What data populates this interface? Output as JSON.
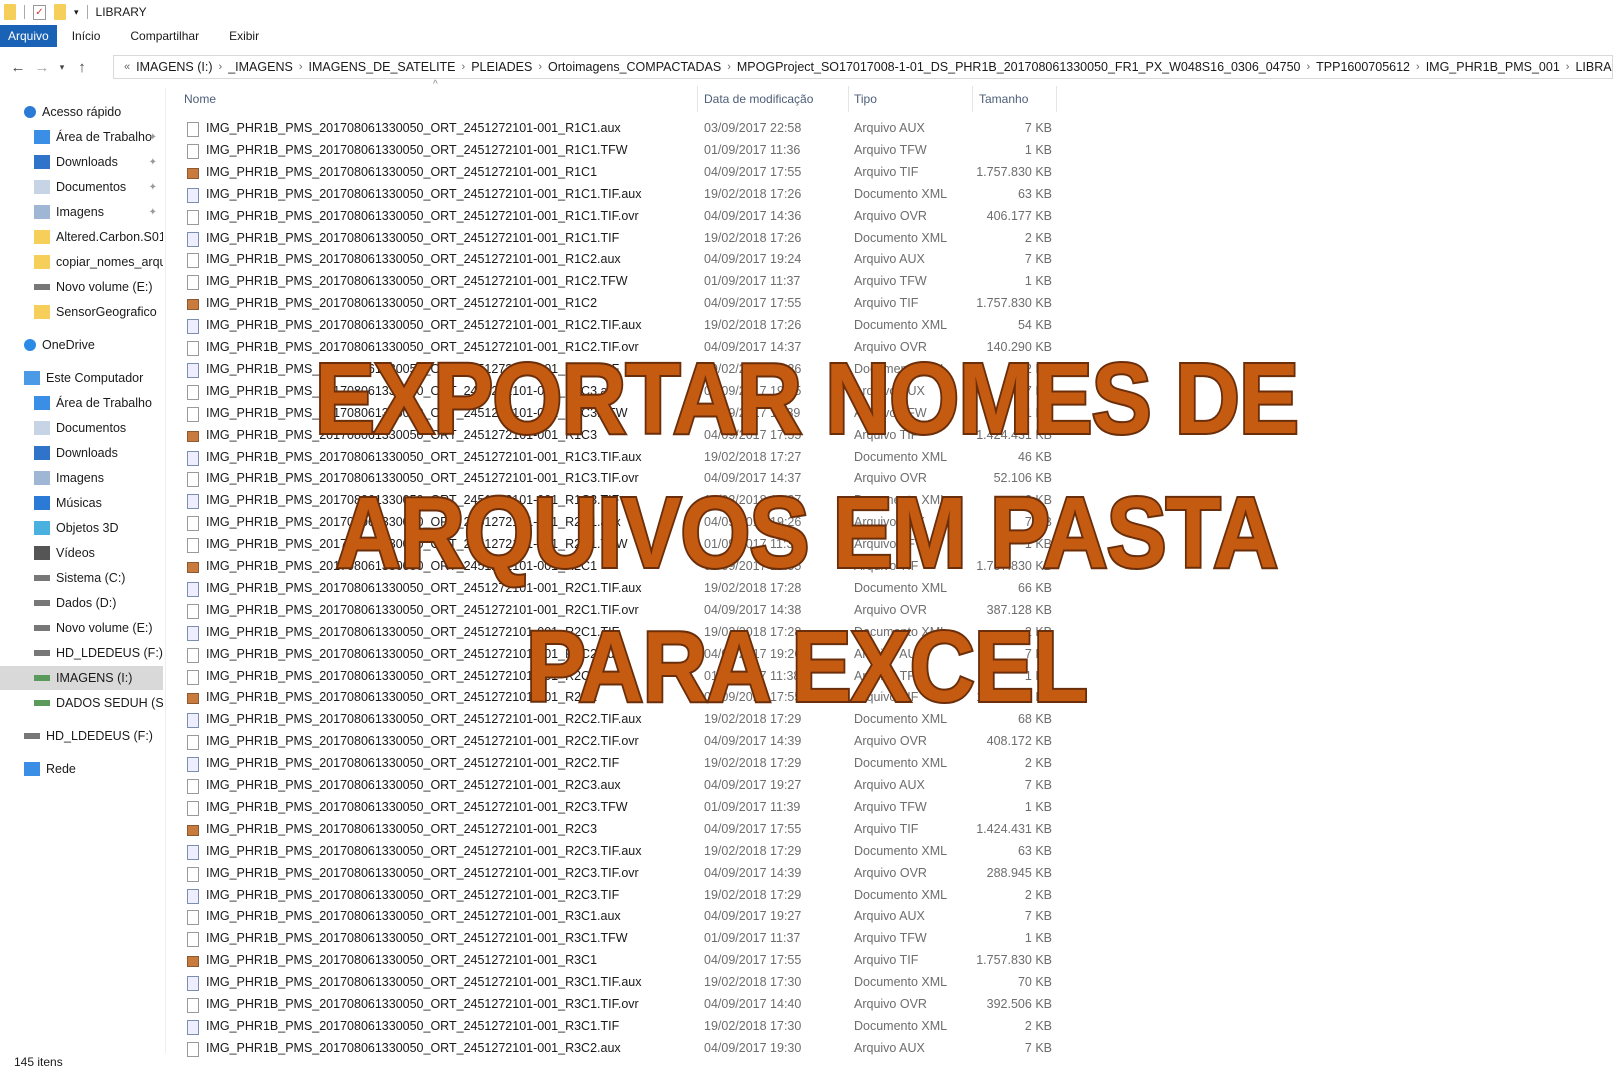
{
  "window": {
    "title": "LIBRARY"
  },
  "ribbon": {
    "tabs": [
      "Arquivo",
      "Início",
      "Compartilhar",
      "Exibir"
    ]
  },
  "address": {
    "prefix": "«",
    "crumbs": [
      "IMAGENS (I:)",
      "_IMAGENS",
      "IMAGENS_DE_SATELITE",
      "PLEIADES",
      "Ortoimagens_COMPACTADAS",
      "MPOGProject_SO17017008-1-01_DS_PHR1B_201708061330050_FR1_PX_W048S16_0306_04750",
      "TPP1600705612",
      "IMG_PHR1B_PMS_001",
      "LIBRARY"
    ]
  },
  "sidebar": {
    "items": [
      {
        "label": "Acesso rápido",
        "icon": "star-icon",
        "pinned": false,
        "level": 0
      },
      {
        "label": "Área de Trabalho",
        "icon": "desktop-icon",
        "pinned": true,
        "level": 1
      },
      {
        "label": "Downloads",
        "icon": "download-icon",
        "pinned": true,
        "level": 1
      },
      {
        "label": "Documentos",
        "icon": "document-icon",
        "pinned": true,
        "level": 1
      },
      {
        "label": "Imagens",
        "icon": "pictures-icon",
        "pinned": true,
        "level": 1
      },
      {
        "label": "Altered.Carbon.S01.",
        "icon": "folder-icon",
        "pinned": false,
        "level": 1
      },
      {
        "label": "copiar_nomes_arqu",
        "icon": "folder-icon",
        "pinned": false,
        "level": 1
      },
      {
        "label": "Novo volume (E:)",
        "icon": "drive-icon",
        "pinned": false,
        "level": 1
      },
      {
        "label": "SensorGeografico",
        "icon": "folder-icon",
        "pinned": false,
        "level": 1
      },
      {
        "label": "OneDrive",
        "icon": "cloud-icon",
        "pinned": false,
        "level": 0,
        "gap": true
      },
      {
        "label": "Este Computador",
        "icon": "computer-icon",
        "pinned": false,
        "level": 0,
        "gap": true
      },
      {
        "label": "Área de Trabalho",
        "icon": "desktop-icon",
        "pinned": false,
        "level": 1
      },
      {
        "label": "Documentos",
        "icon": "document-icon",
        "pinned": false,
        "level": 1
      },
      {
        "label": "Downloads",
        "icon": "download-icon",
        "pinned": false,
        "level": 1
      },
      {
        "label": "Imagens",
        "icon": "pictures-icon",
        "pinned": false,
        "level": 1
      },
      {
        "label": "Músicas",
        "icon": "music-icon",
        "pinned": false,
        "level": 1
      },
      {
        "label": "Objetos 3D",
        "icon": "cube-icon",
        "pinned": false,
        "level": 1
      },
      {
        "label": "Vídeos",
        "icon": "video-icon",
        "pinned": false,
        "level": 1
      },
      {
        "label": "Sistema (C:)",
        "icon": "drive-icon",
        "pinned": false,
        "level": 1
      },
      {
        "label": "Dados (D:)",
        "icon": "drive-icon",
        "pinned": false,
        "level": 1
      },
      {
        "label": "Novo volume (E:)",
        "icon": "drive-icon",
        "pinned": false,
        "level": 1
      },
      {
        "label": "HD_LDEDEUS (F:)",
        "icon": "drive-icon",
        "pinned": false,
        "level": 1
      },
      {
        "label": "IMAGENS (I:)",
        "icon": "network-drive-icon",
        "pinned": false,
        "level": 1,
        "selected": true
      },
      {
        "label": "DADOS SEDUH (S:)",
        "icon": "network-drive-icon",
        "pinned": false,
        "level": 1
      },
      {
        "label": "HD_LDEDEUS (F:)",
        "icon": "drive-icon",
        "pinned": false,
        "level": 0,
        "gap": true
      },
      {
        "label": "Rede",
        "icon": "network-icon",
        "pinned": false,
        "level": 0,
        "gap": true
      }
    ]
  },
  "columns": {
    "name": "Nome",
    "date": "Data de modificação",
    "type": "Tipo",
    "size": "Tamanho"
  },
  "files": [
    [
      "IMG_PHR1B_PMS_201708061330050_ORT_2451272101-001_R1C1.aux",
      "03/09/2017 22:58",
      "Arquivo AUX",
      "7 KB",
      "file"
    ],
    [
      "IMG_PHR1B_PMS_201708061330050_ORT_2451272101-001_R1C1.TFW",
      "01/09/2017 11:36",
      "Arquivo TFW",
      "1 KB",
      "file"
    ],
    [
      "IMG_PHR1B_PMS_201708061330050_ORT_2451272101-001_R1C1",
      "04/09/2017 17:55",
      "Arquivo TIF",
      "1.757.830 KB",
      "tif"
    ],
    [
      "IMG_PHR1B_PMS_201708061330050_ORT_2451272101-001_R1C1.TIF.aux",
      "19/02/2018 17:26",
      "Documento XML",
      "63 KB",
      "xml"
    ],
    [
      "IMG_PHR1B_PMS_201708061330050_ORT_2451272101-001_R1C1.TIF.ovr",
      "04/09/2017 14:36",
      "Arquivo OVR",
      "406.177 KB",
      "file"
    ],
    [
      "IMG_PHR1B_PMS_201708061330050_ORT_2451272101-001_R1C1.TIF",
      "19/02/2018 17:26",
      "Documento XML",
      "2 KB",
      "xml"
    ],
    [
      "IMG_PHR1B_PMS_201708061330050_ORT_2451272101-001_R1C2.aux",
      "04/09/2017 19:24",
      "Arquivo AUX",
      "7 KB",
      "file"
    ],
    [
      "IMG_PHR1B_PMS_201708061330050_ORT_2451272101-001_R1C2.TFW",
      "01/09/2017 11:37",
      "Arquivo TFW",
      "1 KB",
      "file"
    ],
    [
      "IMG_PHR1B_PMS_201708061330050_ORT_2451272101-001_R1C2",
      "04/09/2017 17:55",
      "Arquivo TIF",
      "1.757.830 KB",
      "tif"
    ],
    [
      "IMG_PHR1B_PMS_201708061330050_ORT_2451272101-001_R1C2.TIF.aux",
      "19/02/2018 17:26",
      "Documento XML",
      "54 KB",
      "xml"
    ],
    [
      "IMG_PHR1B_PMS_201708061330050_ORT_2451272101-001_R1C2.TIF.ovr",
      "04/09/2017 14:37",
      "Arquivo OVR",
      "140.290 KB",
      "file"
    ],
    [
      "IMG_PHR1B_PMS_201708061330050_ORT_2451272101-001_R1C2.TIF",
      "19/02/2018 17:26",
      "Documento XML",
      "2 KB",
      "xml"
    ],
    [
      "IMG_PHR1B_PMS_201708061330050_ORT_2451272101-001_R1C3.aux",
      "04/09/2017 19:25",
      "Arquivo AUX",
      "7 KB",
      "file"
    ],
    [
      "IMG_PHR1B_PMS_201708061330050_ORT_2451272101-001_R1C3.TFW",
      "01/09/2017 11:39",
      "Arquivo TFW",
      "1 KB",
      "file"
    ],
    [
      "IMG_PHR1B_PMS_201708061330050_ORT_2451272101-001_R1C3",
      "04/09/2017 17:55",
      "Arquivo TIF",
      "1.424.431 KB",
      "tif"
    ],
    [
      "IMG_PHR1B_PMS_201708061330050_ORT_2451272101-001_R1C3.TIF.aux",
      "19/02/2018 17:27",
      "Documento XML",
      "46 KB",
      "xml"
    ],
    [
      "IMG_PHR1B_PMS_201708061330050_ORT_2451272101-001_R1C3.TIF.ovr",
      "04/09/2017 14:37",
      "Arquivo OVR",
      "52.106 KB",
      "file"
    ],
    [
      "IMG_PHR1B_PMS_201708061330050_ORT_2451272101-001_R1C3.TIF",
      "19/02/2018 17:27",
      "Documento XML",
      "2 KB",
      "xml"
    ],
    [
      "IMG_PHR1B_PMS_201708061330050_ORT_2451272101-001_R2C1.aux",
      "04/09/2017 19:26",
      "Arquivo AUX",
      "7 KB",
      "file"
    ],
    [
      "IMG_PHR1B_PMS_201708061330050_ORT_2451272101-001_R2C1.TFW",
      "01/09/2017 11:38",
      "Arquivo TFW",
      "1 KB",
      "file"
    ],
    [
      "IMG_PHR1B_PMS_201708061330050_ORT_2451272101-001_R2C1",
      "04/09/2017 17:55",
      "Arquivo TIF",
      "1.757.830 KB",
      "tif"
    ],
    [
      "IMG_PHR1B_PMS_201708061330050_ORT_2451272101-001_R2C1.TIF.aux",
      "19/02/2018 17:28",
      "Documento XML",
      "66 KB",
      "xml"
    ],
    [
      "IMG_PHR1B_PMS_201708061330050_ORT_2451272101-001_R2C1.TIF.ovr",
      "04/09/2017 14:38",
      "Arquivo OVR",
      "387.128 KB",
      "file"
    ],
    [
      "IMG_PHR1B_PMS_201708061330050_ORT_2451272101-001_R2C1.TIF",
      "19/02/2018 17:28",
      "Documento XML",
      "2 KB",
      "xml"
    ],
    [
      "IMG_PHR1B_PMS_201708061330050_ORT_2451272101-001_R2C2.aux",
      "04/09/2017 19:26",
      "Arquivo AUX",
      "7 KB",
      "file"
    ],
    [
      "IMG_PHR1B_PMS_201708061330050_ORT_2451272101-001_R2C2.TFW",
      "01/09/2017 11:38",
      "Arquivo TFW",
      "1 KB",
      "file"
    ],
    [
      "IMG_PHR1B_PMS_201708061330050_ORT_2451272101-001_R2C2",
      "04/09/2017 17:55",
      "Arquivo TIF",
      "1.757.830 KB",
      "tif"
    ],
    [
      "IMG_PHR1B_PMS_201708061330050_ORT_2451272101-001_R2C2.TIF.aux",
      "19/02/2018 17:29",
      "Documento XML",
      "68 KB",
      "xml"
    ],
    [
      "IMG_PHR1B_PMS_201708061330050_ORT_2451272101-001_R2C2.TIF.ovr",
      "04/09/2017 14:39",
      "Arquivo OVR",
      "408.172 KB",
      "file"
    ],
    [
      "IMG_PHR1B_PMS_201708061330050_ORT_2451272101-001_R2C2.TIF",
      "19/02/2018 17:29",
      "Documento XML",
      "2 KB",
      "xml"
    ],
    [
      "IMG_PHR1B_PMS_201708061330050_ORT_2451272101-001_R2C3.aux",
      "04/09/2017 19:27",
      "Arquivo AUX",
      "7 KB",
      "file"
    ],
    [
      "IMG_PHR1B_PMS_201708061330050_ORT_2451272101-001_R2C3.TFW",
      "01/09/2017 11:39",
      "Arquivo TFW",
      "1 KB",
      "file"
    ],
    [
      "IMG_PHR1B_PMS_201708061330050_ORT_2451272101-001_R2C3",
      "04/09/2017 17:55",
      "Arquivo TIF",
      "1.424.431 KB",
      "tif"
    ],
    [
      "IMG_PHR1B_PMS_201708061330050_ORT_2451272101-001_R2C3.TIF.aux",
      "19/02/2018 17:29",
      "Documento XML",
      "63 KB",
      "xml"
    ],
    [
      "IMG_PHR1B_PMS_201708061330050_ORT_2451272101-001_R2C3.TIF.ovr",
      "04/09/2017 14:39",
      "Arquivo OVR",
      "288.945 KB",
      "file"
    ],
    [
      "IMG_PHR1B_PMS_201708061330050_ORT_2451272101-001_R2C3.TIF",
      "19/02/2018 17:29",
      "Documento XML",
      "2 KB",
      "xml"
    ],
    [
      "IMG_PHR1B_PMS_201708061330050_ORT_2451272101-001_R3C1.aux",
      "04/09/2017 19:27",
      "Arquivo AUX",
      "7 KB",
      "file"
    ],
    [
      "IMG_PHR1B_PMS_201708061330050_ORT_2451272101-001_R3C1.TFW",
      "01/09/2017 11:37",
      "Arquivo TFW",
      "1 KB",
      "file"
    ],
    [
      "IMG_PHR1B_PMS_201708061330050_ORT_2451272101-001_R3C1",
      "04/09/2017 17:55",
      "Arquivo TIF",
      "1.757.830 KB",
      "tif"
    ],
    [
      "IMG_PHR1B_PMS_201708061330050_ORT_2451272101-001_R3C1.TIF.aux",
      "19/02/2018 17:30",
      "Documento XML",
      "70 KB",
      "xml"
    ],
    [
      "IMG_PHR1B_PMS_201708061330050_ORT_2451272101-001_R3C1.TIF.ovr",
      "04/09/2017 14:40",
      "Arquivo OVR",
      "392.506 KB",
      "file"
    ],
    [
      "IMG_PHR1B_PMS_201708061330050_ORT_2451272101-001_R3C1.TIF",
      "19/02/2018 17:30",
      "Documento XML",
      "2 KB",
      "xml"
    ],
    [
      "IMG_PHR1B_PMS_201708061330050_ORT_2451272101-001_R3C2.aux",
      "04/09/2017 19:30",
      "Arquivo AUX",
      "7 KB",
      "file"
    ]
  ],
  "status": {
    "count": "145 itens"
  },
  "overlay": {
    "lines": [
      "EXPORTAR NOMES DE",
      "ARQUIVOS EM PASTA",
      "PARA EXCEL"
    ],
    "color": "#c55a11",
    "outline": "#6b2e0a"
  }
}
